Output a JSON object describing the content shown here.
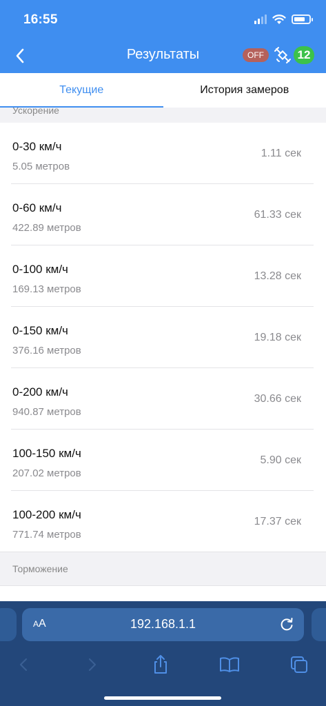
{
  "status_bar": {
    "time": "16:55",
    "battery_level": 0.75
  },
  "header": {
    "title": "Результаты",
    "gps_toggle": "OFF",
    "satellite_count": "12"
  },
  "tabs": [
    {
      "label": "Текущие",
      "active": true
    },
    {
      "label": "История замеров",
      "active": false
    }
  ],
  "sections": {
    "acceleration": {
      "title": "Ускорение",
      "rows": [
        {
          "title": "0-30 км/ч",
          "distance": "5.05 метров",
          "time": "1.11 сек"
        },
        {
          "title": "0-60 км/ч",
          "distance": "422.89 метров",
          "time": "61.33 сек"
        },
        {
          "title": "0-100 км/ч",
          "distance": "169.13 метров",
          "time": "13.28 сек"
        },
        {
          "title": "0-150 км/ч",
          "distance": "376.16 метров",
          "time": "19.18 сек"
        },
        {
          "title": "0-200 км/ч",
          "distance": "940.87 метров",
          "time": "30.66 сек"
        },
        {
          "title": "100-150 км/ч",
          "distance": "207.02 метров",
          "time": "5.90 сек"
        },
        {
          "title": "100-200 км/ч",
          "distance": "771.74 метров",
          "time": "17.37 сек"
        }
      ]
    },
    "braking": {
      "title": "Торможение"
    }
  },
  "browser": {
    "text_size_label": "AA",
    "url": "192.168.1.1"
  },
  "colors": {
    "accent": "#3f8ef0",
    "off_badge": "#b5615b",
    "sat_badge": "#3cc24a",
    "browser_bg": "#23477a"
  }
}
